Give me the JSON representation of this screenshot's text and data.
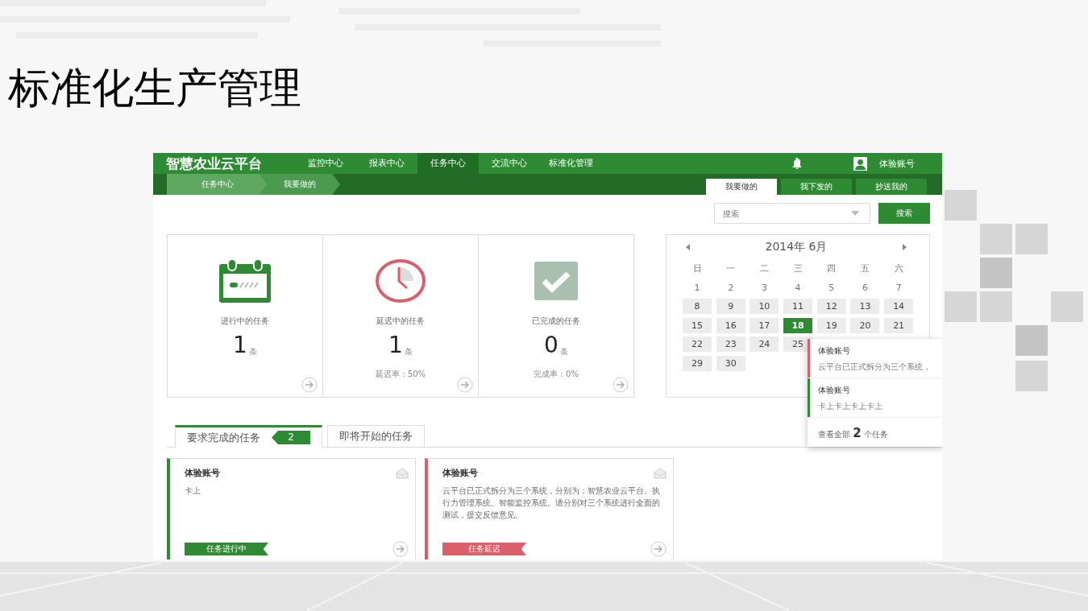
{
  "slide": {
    "title": "标准化生产管理"
  },
  "app": {
    "logo": "智慧农业云平台",
    "nav": [
      {
        "label": "监控中心",
        "selected": false
      },
      {
        "label": "报表中心",
        "selected": false
      },
      {
        "label": "任务中心",
        "selected": true
      },
      {
        "label": "交流中心",
        "selected": false
      },
      {
        "label": "标准化管理",
        "selected": false
      }
    ],
    "user": "体验账号",
    "breadcrumb": [
      "任务中心",
      "我要做的"
    ],
    "view_tabs": [
      {
        "label": "我要做的",
        "selected": true
      },
      {
        "label": "我下发的",
        "selected": false
      },
      {
        "label": "抄送我的",
        "selected": false
      }
    ],
    "search": {
      "placeholder": "搜索",
      "button": "搜索"
    },
    "stats": [
      {
        "kind": "in_progress",
        "label": "进行中的任务",
        "count": "1",
        "unit": "条"
      },
      {
        "kind": "delayed",
        "label": "延迟中的任务",
        "count": "1",
        "unit": "条",
        "rate": "延迟率：50%"
      },
      {
        "kind": "done",
        "label": "已完成的任务",
        "count": "0",
        "unit": "条",
        "rate": "完成率：0%"
      }
    ],
    "calendar": {
      "title": "2014年 6月",
      "weekdays": [
        "日",
        "一",
        "二",
        "三",
        "四",
        "五",
        "六"
      ],
      "weeks": [
        [
          {
            "label": "1",
            "shaded": false,
            "selected": false
          },
          {
            "label": "2",
            "shaded": false,
            "selected": false
          },
          {
            "label": "3",
            "shaded": false,
            "selected": false
          },
          {
            "label": "4",
            "shaded": false,
            "selected": false
          },
          {
            "label": "5",
            "shaded": false,
            "selected": false
          },
          {
            "label": "6",
            "shaded": false,
            "selected": false
          },
          {
            "label": "7",
            "shaded": false,
            "selected": false
          }
        ],
        [
          {
            "label": "8",
            "shaded": true,
            "selected": false
          },
          {
            "label": "9",
            "shaded": true,
            "selected": false
          },
          {
            "label": "10",
            "shaded": true,
            "selected": false
          },
          {
            "label": "11",
            "shaded": true,
            "selected": false
          },
          {
            "label": "12",
            "shaded": true,
            "selected": false
          },
          {
            "label": "13",
            "shaded": true,
            "selected": false
          },
          {
            "label": "14",
            "shaded": true,
            "selected": false
          }
        ],
        [
          {
            "label": "15",
            "shaded": true,
            "selected": false
          },
          {
            "label": "16",
            "shaded": true,
            "selected": false
          },
          {
            "label": "17",
            "shaded": true,
            "selected": false
          },
          {
            "label": "18",
            "shaded": true,
            "selected": true
          },
          {
            "label": "19",
            "shaded": true,
            "selected": false
          },
          {
            "label": "20",
            "shaded": true,
            "selected": false
          },
          {
            "label": "21",
            "shaded": true,
            "selected": false
          }
        ],
        [
          {
            "label": "22",
            "shaded": true,
            "selected": false
          },
          {
            "label": "23",
            "shaded": true,
            "selected": false
          },
          {
            "label": "24",
            "shaded": true,
            "selected": false
          },
          {
            "label": "25",
            "shaded": true,
            "selected": false
          }
        ],
        [
          {
            "label": "29",
            "shaded": true,
            "selected": false
          },
          {
            "label": "30",
            "shaded": true,
            "selected": false
          }
        ]
      ]
    },
    "popup": {
      "items": [
        {
          "title": "体验账号",
          "text": "云平台已正式拆分为三个系统，",
          "color": "#d9606b"
        },
        {
          "title": "体验账号",
          "text": "卡上卡上卡上卡上",
          "color": "#2e8b34"
        }
      ],
      "footer": "查看全部 **2** 个任务"
    },
    "task_tabs": [
      {
        "label": "要求完成的任务",
        "selected": true,
        "badge": "2"
      },
      {
        "label": "即将开始的任务",
        "selected": false
      }
    ],
    "tasks": [
      {
        "title": "体验账号",
        "text": "卡上",
        "status": "任务进行中",
        "color": "#2e8b34"
      },
      {
        "title": "体验账号",
        "text": "云平台已正式拆分为三个系统，分别为：智慧农业云平台、执行力管理系统、智能监控系统。请分别对三个系统进行全面的测试，提交反馈意见。",
        "status": "任务延迟",
        "color": "#d9606b"
      }
    ]
  }
}
